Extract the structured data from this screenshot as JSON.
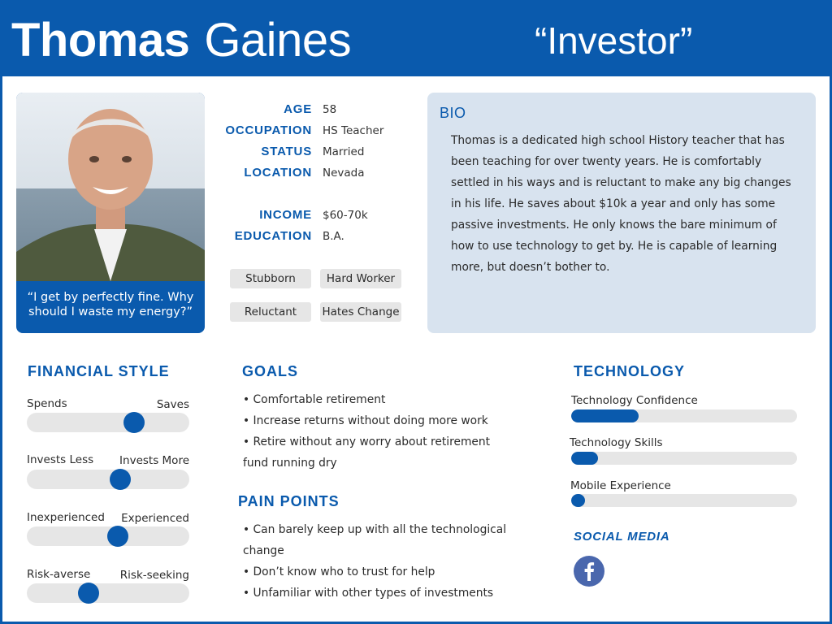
{
  "header": {
    "first_name": "Thomas",
    "last_name": "Gaines",
    "persona_type": "“Investor”"
  },
  "profile": {
    "quote": "“I get by perfectly fine. Why should I waste my energy?”",
    "facts": [
      {
        "label": "AGE",
        "value": "58"
      },
      {
        "label": "OCCUPATION",
        "value": "HS Teacher"
      },
      {
        "label": "STATUS",
        "value": "Married"
      },
      {
        "label": "LOCATION",
        "value": "Nevada"
      },
      {
        "label": "INCOME",
        "value": "$60-70k"
      },
      {
        "label": "EDUCATION",
        "value": "B.A."
      }
    ],
    "tags": [
      "Stubborn",
      "Hard Worker",
      "Reluctant",
      "Hates Change"
    ]
  },
  "bio": {
    "title": "BIO",
    "text": "Thomas is a dedicated high school History teacher that has been teaching for over twenty years. He is comfortably settled in his ways and is reluctant to make any big changes in his life. He saves about $10k a year and only has some passive investments. He only knows the bare minimum of how to use technology to get by. He is capable of learning more, but doesn’t bother to."
  },
  "financial_style": {
    "title": "FINANCIAL STYLE",
    "sliders": [
      {
        "left": "Spends",
        "right": "Saves",
        "level": 0.66
      },
      {
        "left": "Invests Less",
        "right": "Invests More",
        "level": 0.575
      },
      {
        "left": "Inexperienced",
        "right": "Experienced",
        "level": 0.56
      },
      {
        "left": "Risk-averse",
        "right": "Risk-seeking",
        "level": 0.38
      }
    ]
  },
  "goals": {
    "title": "GOALS",
    "items": [
      "• Comfortable retirement",
      "• Increase returns without doing more work",
      "• Retire without any worry about retirement fund running dry"
    ]
  },
  "pain_points": {
    "title": "PAIN POINTS",
    "items": [
      "• Can barely keep up with all the technological change",
      "• Don’t know who to trust for help",
      "• Unfamiliar with other types of investments"
    ]
  },
  "technology": {
    "title": "TECHNOLOGY",
    "bars": [
      {
        "label": "Technology Confidence",
        "level": 0.3
      },
      {
        "label": "Technology Skills",
        "level": 0.12
      },
      {
        "label": "Mobile Experience",
        "level": 0.06
      }
    ]
  },
  "social_media": {
    "title": "SOCIAL MEDIA",
    "icons": [
      "facebook-icon"
    ]
  },
  "colors": {
    "brand_blue": "#0a5aad",
    "bio_background": "#d8e3ef",
    "track_gray": "#e6e6e6",
    "facebook_blue": "#4a67ad"
  }
}
